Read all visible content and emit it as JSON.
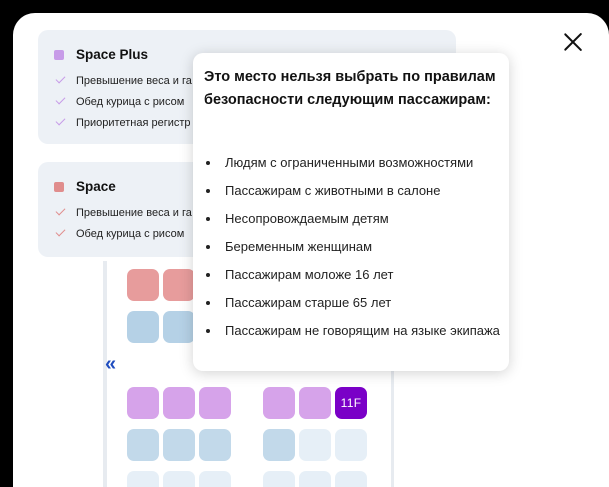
{
  "modal": {
    "close_label": "×"
  },
  "tariffs": [
    {
      "name": "Space Plus",
      "color": "#c79be8",
      "features": [
        "Превышение веса и га",
        "Обед курица с рисом",
        "Приоритетная регистр"
      ]
    },
    {
      "name": "Space",
      "color": "#e08d8d",
      "features": [
        "Превышение веса и га",
        "Обед курица с рисом"
      ]
    }
  ],
  "seat_map": {
    "nav_prev": "«",
    "selected_seat": "11F",
    "colors": {
      "space": "#e79c9c",
      "space_plus": "#d6a3ea",
      "selected": "#7a00c7",
      "standard": "#b5d1e6",
      "unavailable": "#e6eff7"
    }
  },
  "tooltip": {
    "title": "Это место нельзя выбрать по правилам безопасности следующим пассажирам:",
    "items": [
      "Людям с ограниченными возможностями",
      "Пассажирам с животными в салоне",
      "Несопровождаемым детям",
      "Беременным женщинам",
      "Пассажирам моложе 16 лет",
      "Пассажирам старше 65 лет",
      "Пассажирам не говорящим на языке экипажа"
    ]
  }
}
